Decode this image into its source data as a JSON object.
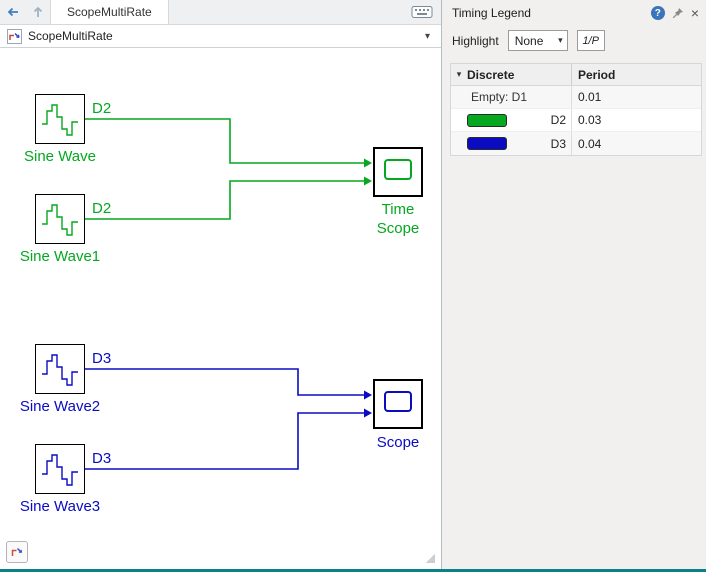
{
  "colors": {
    "d2": "#05a81f",
    "d3": "#0b0bc2",
    "teal": "#0d8086",
    "accent": "#3f7fbf"
  },
  "icons": {
    "caret_down": "▾",
    "chevron_down": "▾",
    "close": "×",
    "help": "?"
  },
  "editor": {
    "tab_label": "ScopeMultiRate",
    "address": "ScopeMultiRate",
    "canvas": {
      "blocks": [
        {
          "label": "Sine Wave",
          "rate": "D2"
        },
        {
          "label": "Sine Wave1",
          "rate": "D2"
        },
        {
          "label": "Sine Wave2",
          "rate": "D3"
        },
        {
          "label": "Sine Wave3",
          "rate": "D3"
        },
        {
          "label": "Time Scope"
        },
        {
          "label": "Scope"
        }
      ]
    }
  },
  "panel": {
    "title": "Timing Legend",
    "highlight_label": "Highlight",
    "highlight_value": "None",
    "period_toggle_label": "1/P",
    "table": {
      "col_discrete": "Discrete",
      "col_period": "Period",
      "rows": [
        {
          "label": "Empty: D1",
          "period": "0.01"
        },
        {
          "label": "D2",
          "period": "0.03",
          "swatch": "#05a81f"
        },
        {
          "label": "D3",
          "period": "0.04",
          "swatch": "#0b0bc2"
        }
      ]
    }
  }
}
